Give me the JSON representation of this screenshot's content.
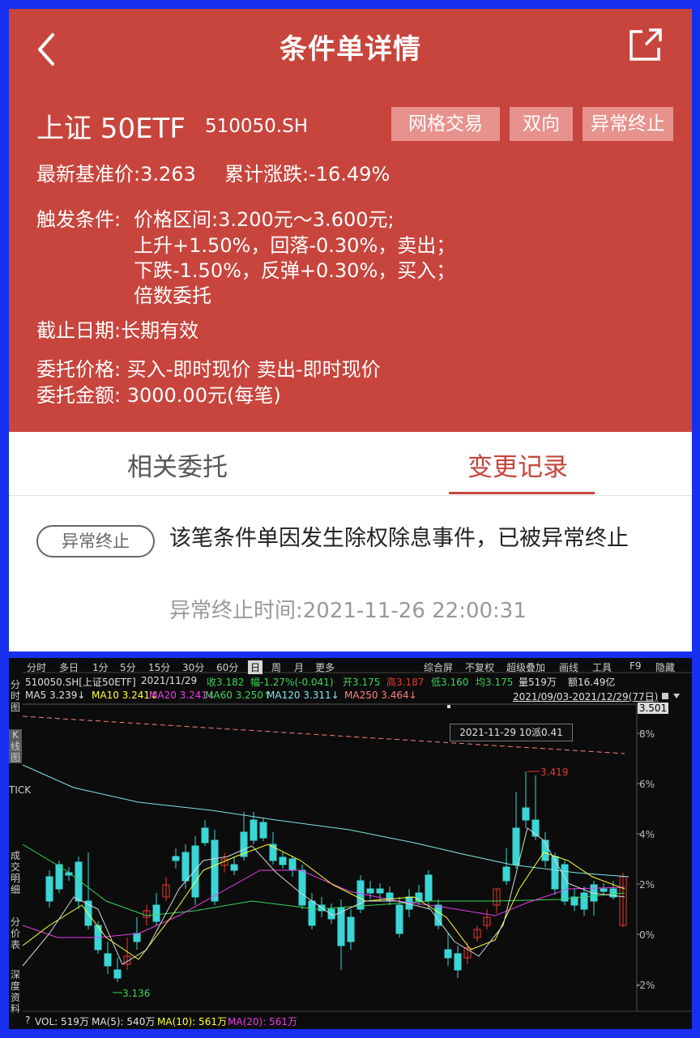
{
  "header": {
    "title": "条件单详情",
    "stock_name": "上证 50ETF",
    "stock_code": "510050.SH",
    "tags": [
      "网格交易",
      "双向",
      "异常终止"
    ],
    "base_price": "最新基准价:3.263",
    "cum_change": "累计涨跌:-16.49%",
    "trigger_label": "触发条件:",
    "trigger_lines": [
      "价格区间:3.200元～3.600元;",
      "上升+1.50%，回落-0.30%，卖出；",
      "下跌-1.50%，反弹+0.30%，买入；",
      "倍数委托"
    ],
    "expiry": "截止日期:长期有效",
    "order_price": "委托价格: 买入-即时现价 卖出-即时现价",
    "order_amount": "委托金额: 3000.00元(每笔)"
  },
  "tabs": {
    "related": "相关委托",
    "changes": "变更记录"
  },
  "record": {
    "badge": "异常终止",
    "message": "该笔条件单因发生除权除息事件，已被异常终止",
    "time": "异常终止时间:2021-11-26 22:00:31"
  },
  "chart_toolbar": {
    "left": [
      "分时",
      "多日",
      "1分",
      "5分",
      "15分",
      "30分",
      "60分",
      "日",
      "周",
      "月",
      "更多"
    ],
    "selected": "日",
    "right": [
      "综合屏",
      "不复权",
      "超级叠加",
      "画线",
      "工具",
      "F9",
      "隐藏"
    ]
  },
  "quote": {
    "symbol": "510050.SH[上证50ETF]",
    "date": "2021/11/29",
    "close": "收3.182",
    "range": "幅-1.27%(-0.041)",
    "open": "开3.175",
    "high": "高3.187",
    "low": "低3.160",
    "avg": "均3.175",
    "vol": "量519万",
    "amount": "额16.49亿"
  },
  "ma_line": {
    "ma5": "MA5 3.239↓",
    "ma10": "MA10 3.241↓",
    "ma20": "MA20 3.241↓",
    "ma60": "MA60 3.250↑",
    "ma120": "MA120 3.311↓",
    "ma250": "MA250 3.464↓",
    "period": "2021/09/03-2021/12/29(77日)"
  },
  "side_tabs": [
    "分时图",
    "K线图",
    "TICK",
    "成交明细",
    "分价表",
    "深度资料"
  ],
  "side_selected": "K线图",
  "price_box": "3.501",
  "event_label": "2021-11-29  10派0.41",
  "high_label": "3.419",
  "low_label": "3.136",
  "vol_line": {
    "q": "?",
    "vol": "VOL: 519万",
    "ma5": "MA(5): 540万",
    "ma10": "MA(10): 561万",
    "ma20": "MA(20): 561万"
  },
  "colors": {
    "header_red": "#c7453d",
    "up": "#e8372f",
    "down": "#3ad6d6"
  },
  "chart_data": {
    "type": "candlestick",
    "x_range": [
      "2021/09/03",
      "2021/12/29"
    ],
    "y_axis_percent_ticks": [
      "8%",
      "6%",
      "4%",
      "2%",
      "0%",
      "-2%"
    ],
    "annotations": [
      "3.419",
      "3.136",
      "2021-11-29  10派0.41"
    ],
    "marked_high": 3.419,
    "marked_low": 3.136
  }
}
